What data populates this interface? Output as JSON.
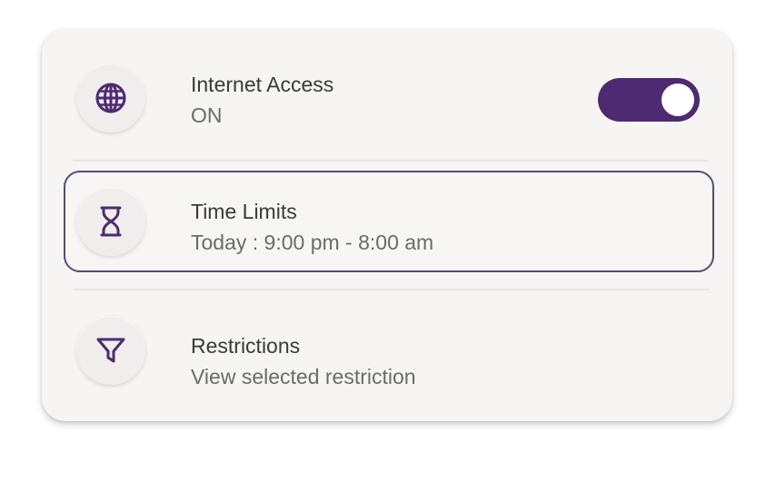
{
  "accent_color": "#4d2a72",
  "rows": [
    {
      "title": "Internet Access",
      "subtitle": "ON",
      "icon": "globe-icon",
      "toggle_on": true
    },
    {
      "title": "Time Limits",
      "subtitle": "Today : 9:00 pm - 8:00 am",
      "icon": "hourglass-icon",
      "selected": true
    },
    {
      "title": "Restrictions",
      "subtitle": "View selected restriction",
      "icon": "filter-icon"
    }
  ]
}
